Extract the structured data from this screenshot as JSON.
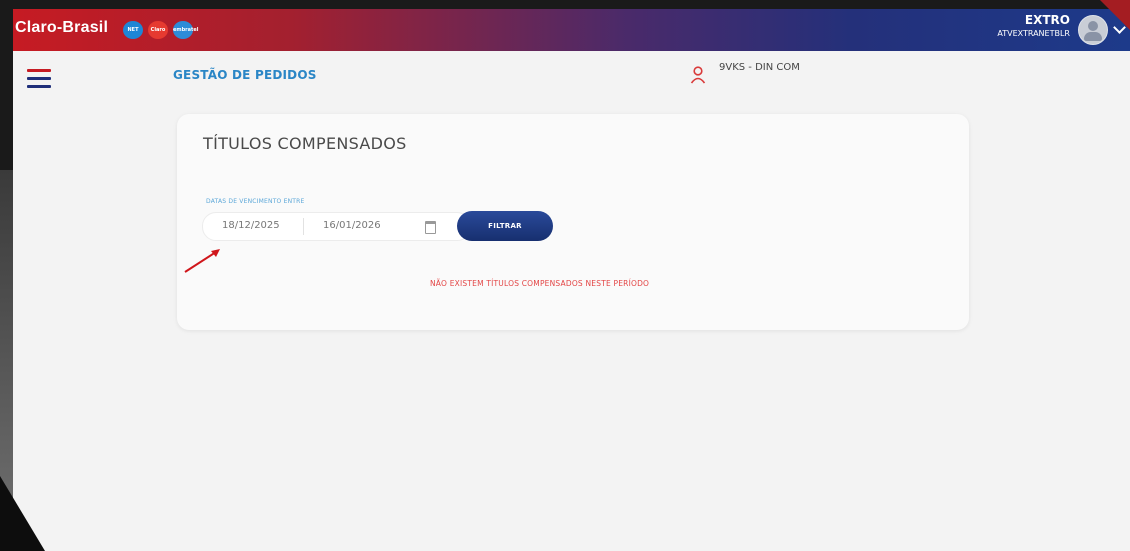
{
  "header": {
    "brand": "Claro-Brasil",
    "badges": [
      {
        "label": "NET",
        "color": "#1e86d6"
      },
      {
        "label": "Claro",
        "color": "#e63a30"
      },
      {
        "label": "embratel",
        "color": "#2d8cd8"
      }
    ],
    "user_name": "EXTRO",
    "user_id": "ATVEXTRANETBLR"
  },
  "nav": {
    "page_title": "GESTÃO DE PEDIDOS",
    "company_name": "9VKS - DIN COM"
  },
  "card": {
    "title": "TÍTULOS COMPENSADOS",
    "date_label": "DATAS DE VENCIMENTO ENTRE",
    "date_start": "18/12/2025",
    "date_end": "16/01/2026",
    "filter_button": "FILTRAR",
    "empty_message": "NÃO EXISTEM TÍTULOS COMPENSADOS NESTE PERÍODO"
  },
  "colors": {
    "accent_red": "#c61b23",
    "accent_blue": "#1f2f7a",
    "title_blue": "#2a86c6",
    "error_red": "#e34545"
  },
  "icons": [
    "menu-icon",
    "user-icon",
    "calendar-icon",
    "chevron-down-icon",
    "avatar-icon"
  ]
}
